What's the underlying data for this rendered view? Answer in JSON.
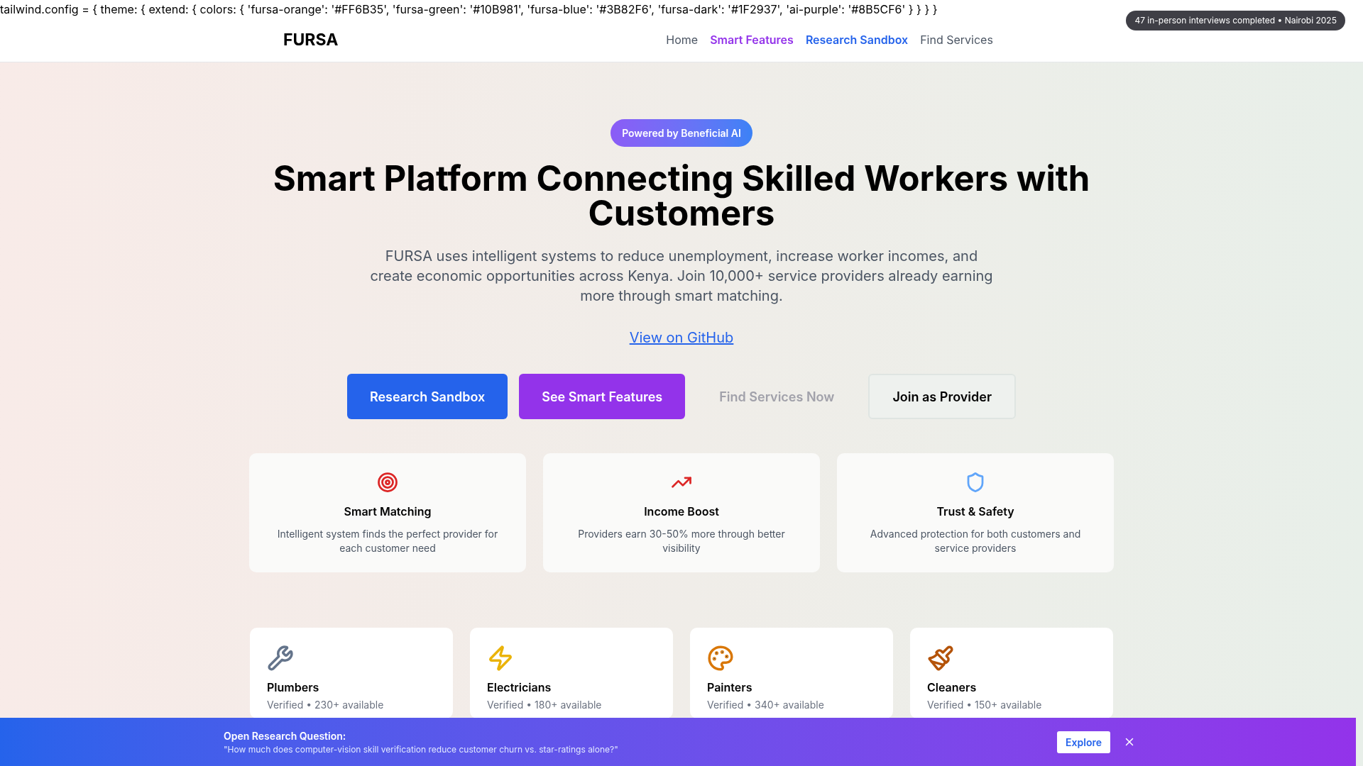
{
  "config_text": "tailwind.config = { theme: { extend: { colors: { 'fursa-orange': '#FF6B35', 'fursa-green': '#10B981', 'fursa-blue': '#3B82F6', 'fursa-dark': '#1F2937', 'ai-purple': '#8B5CF6' } } } }",
  "corner_badge": "47 in-person interviews completed • Nairobi 2025",
  "nav": {
    "logo": "FURSA",
    "links": [
      {
        "label": "Home",
        "color": "#4b5563"
      },
      {
        "label": "Smart Features",
        "color": "#9333ea"
      },
      {
        "label": "Research Sandbox",
        "color": "#2563eb"
      },
      {
        "label": "Find Services",
        "color": "#4b5563"
      }
    ]
  },
  "hero": {
    "badge": "Powered by Beneficial AI",
    "title": "Smart Platform Connecting Skilled Workers with Customers",
    "subtitle": "FURSA uses intelligent systems to reduce unemployment, increase worker incomes, and create economic opportunities across Kenya. Join 10,000+ service providers already earning more through smart matching.",
    "link": "View on GitHub",
    "buttons": [
      {
        "label": "Research Sandbox",
        "kind": "blue"
      },
      {
        "label": "See Smart Features",
        "kind": "purple"
      },
      {
        "label": "Find Services Now",
        "kind": "ghost"
      },
      {
        "label": "Join as Provider",
        "kind": "outline"
      }
    ]
  },
  "features": [
    {
      "title": "Smart Matching",
      "text": "Intelligent system finds the perfect provider for each customer need"
    },
    {
      "title": "Income Boost",
      "text": "Providers earn 30-50% more through better visibility"
    },
    {
      "title": "Trust & Safety",
      "text": "Advanced protection for both customers and service providers"
    }
  ],
  "services": [
    {
      "title": "Plumbers",
      "text": "Verified • 230+ available"
    },
    {
      "title": "Electricians",
      "text": "Verified • 180+ available"
    },
    {
      "title": "Painters",
      "text": "Verified • 340+ available"
    },
    {
      "title": "Cleaners",
      "text": "Verified • 150+ available"
    }
  ],
  "research_bar": {
    "title": "Open Research Question:",
    "question": "\"How much does computer-vision skill verification reduce customer churn vs. star-ratings alone?\"",
    "button": "Explore"
  }
}
